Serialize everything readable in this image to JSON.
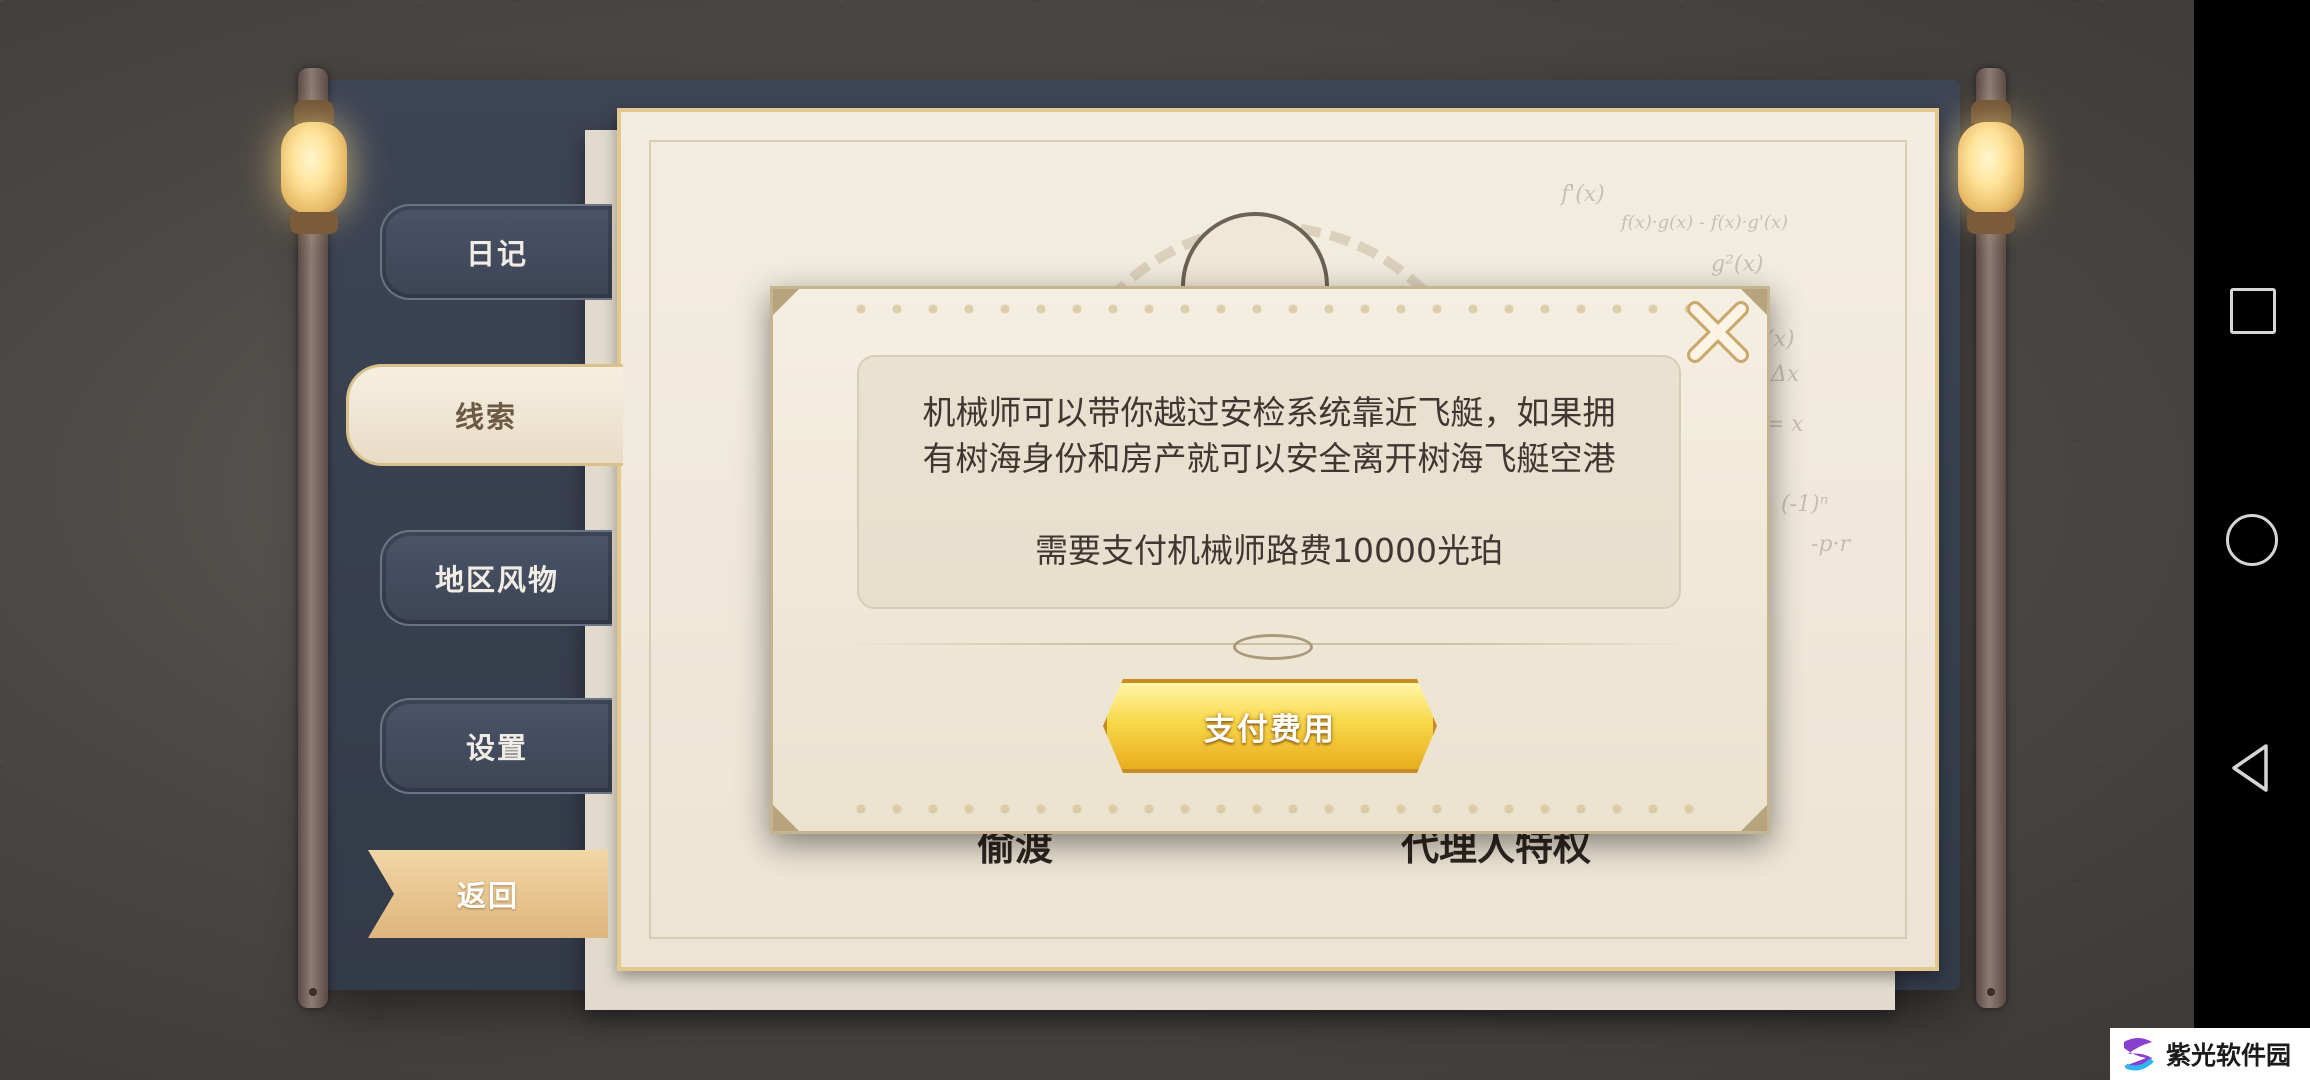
{
  "nav": {
    "items": [
      {
        "label": "日记"
      },
      {
        "label": "线索"
      },
      {
        "label": "地区风物"
      },
      {
        "label": "设置"
      }
    ],
    "back_label": "返回"
  },
  "paper": {
    "label_left": "偷渡",
    "label_right": "代理人特权",
    "formulas": [
      "f'(x)",
      "f(x)·g(x) - f(x)·g'(x)",
      "g²(x)",
      "f(x+Δx) - f(x)",
      "Δx",
      "f(x) = x",
      "(-1)ⁿ",
      "-p·r"
    ]
  },
  "modal": {
    "message_line1": "机械师可以带你越过安检系统靠近飞艇，如果拥",
    "message_line2": "有树海身份和房产就可以安全离开树海飞艇空港",
    "cost_line": "需要支付机械师路费10000光珀",
    "pay_button": "支付费用"
  },
  "watermark": {
    "text": "紫光软件园"
  },
  "colors": {
    "accent_gold": "#f8d84a",
    "nav_dark": "#4b5468",
    "paper": "#f3ede1"
  }
}
